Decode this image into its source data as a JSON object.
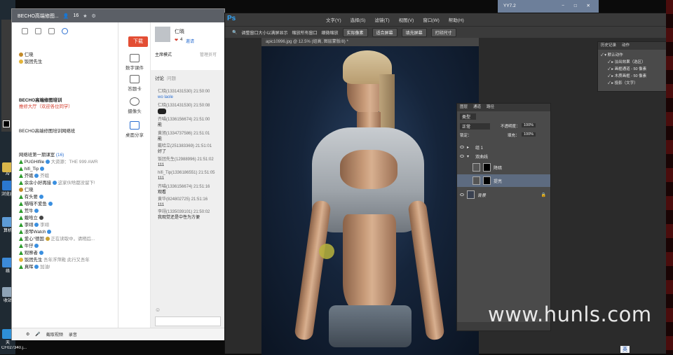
{
  "desktop": {
    "items": [
      {
        "label": "Ar"
      },
      {
        "label": "浏览器"
      },
      {
        "label": "算机"
      },
      {
        "label": "络"
      },
      {
        "label": "收站"
      },
      {
        "label": "天"
      },
      {
        "label": "CF027340.j..."
      }
    ]
  },
  "chat": {
    "title": "BECHO高端修图...",
    "member_count": "16",
    "user1": "仁晓",
    "user2": "饭团先生",
    "group_name": "BECHO高端修图培训",
    "welcome": "推修大厅（欢迎各位同学）",
    "group2": "BECHO高端修图培训网络班",
    "list_header": "网络班第一期课室",
    "list_count": "(16)",
    "members": [
      {
        "name": "PUGHIfile",
        "note": "大资源：THE 999 AWR"
      },
      {
        "name": "hifi_Tip",
        "note": ""
      },
      {
        "name": "芥蛾",
        "note": "芥蛾"
      },
      {
        "name": "余余小好再接",
        "note": "这家伙啥都没留下!"
      },
      {
        "name": "仁晓",
        "note": ""
      },
      {
        "name": "有头要",
        "note": ""
      },
      {
        "name": "喵喵不爱鱼",
        "note": ""
      },
      {
        "name": "荒牛",
        "note": ""
      },
      {
        "name": "戴哈立",
        "note": ""
      },
      {
        "name": "李翊",
        "note": "李翊"
      },
      {
        "name": "浪琴Watch",
        "note": ""
      },
      {
        "name": "爱心°德国",
        "note": "正在读取中，请稍后..."
      },
      {
        "name": "牛仔",
        "note": ""
      },
      {
        "name": "观察者",
        "note": ""
      },
      {
        "name": "饭团先生",
        "note": "吾年浮萍殿 此行又吾年"
      },
      {
        "name": "真晖",
        "note": "加油!"
      }
    ],
    "buttons": {
      "download": "下载",
      "tutorial": "数字课件",
      "answer": "答题卡",
      "camera": "摄像头",
      "share": "桌面分享"
    },
    "teacher": "仁晓",
    "likes": "4",
    "invite": "邀请",
    "host_mode": "主席模式",
    "manage": "管理员可",
    "tabs": {
      "discuss": "讨论",
      "question": "问题"
    },
    "messages": [
      {
        "who": "仁晓(1331431530) 21:50:00",
        "text": "wo laole"
      },
      {
        "who": "仁晓(1331431530) 21:50:08",
        "text": ""
      },
      {
        "who": "齐喵(1336156674) 21:51:00",
        "text": "能"
      },
      {
        "who": "黄旭(1334737586) 21:51:01",
        "text": "能"
      },
      {
        "who": "戴哈立(251383369) 21:51:01",
        "text": "好了"
      },
      {
        "who": "饭团先生(12988996) 21:51:02",
        "text": "111"
      },
      {
        "who": "hifi_Tip(1336186551) 21:51:05",
        "text": "111"
      },
      {
        "who": "齐喵(1336156674) 21:51:16",
        "text": "观看"
      },
      {
        "who": "黄华(824802725) 21:51:16",
        "text": "111"
      },
      {
        "who": "李翊(1335039101) 21:50:02",
        "text": "我观觉还是中性为方便"
      }
    ],
    "bottom": {
      "screen": "截取视频",
      "record": "录音"
    }
  },
  "ps": {
    "logo": "Ps",
    "menu": [
      "文字(Y)",
      "选择(S)",
      "滤镜(T)",
      "视图(V)",
      "窗口(W)",
      "帮助(H)"
    ],
    "options": {
      "resize": "调整窗口大小以满屏显示",
      "zoom_all": "缩放所有窗口",
      "scrubby": "细微缩放",
      "actual": "实际像素",
      "fit": "适合屏幕",
      "fill": "填充屏幕",
      "print": "打印尺寸"
    },
    "doc_tab": "apic10996.jpg @ 12.5% (组高, 图层蒙版/8) *",
    "layers": {
      "tabs": [
        "图层",
        "通道",
        "路径"
      ],
      "kind": "类型",
      "blend": "正常",
      "opacity_label": "不透明度：",
      "opacity": "100%",
      "lock_label": "锁定：",
      "fill_label": "填充：",
      "fill": "100%",
      "rows": [
        {
          "name": "组 1"
        },
        {
          "name": "双曲线"
        },
        {
          "name": "降暗"
        },
        {
          "name": "提亮"
        },
        {
          "name": "背景"
        }
      ]
    },
    "actions": {
      "tabs": [
        "历史记录",
        "动作"
      ],
      "rows": [
        "默认动作",
        "淡出效果（选区）",
        "画框通道 - 50 像素",
        "木质画框 - 50 像素",
        "投影（文字）"
      ]
    }
  },
  "small_window": {
    "title": "YY7.2"
  },
  "watermark": "www.hunls.com",
  "ime": "英"
}
